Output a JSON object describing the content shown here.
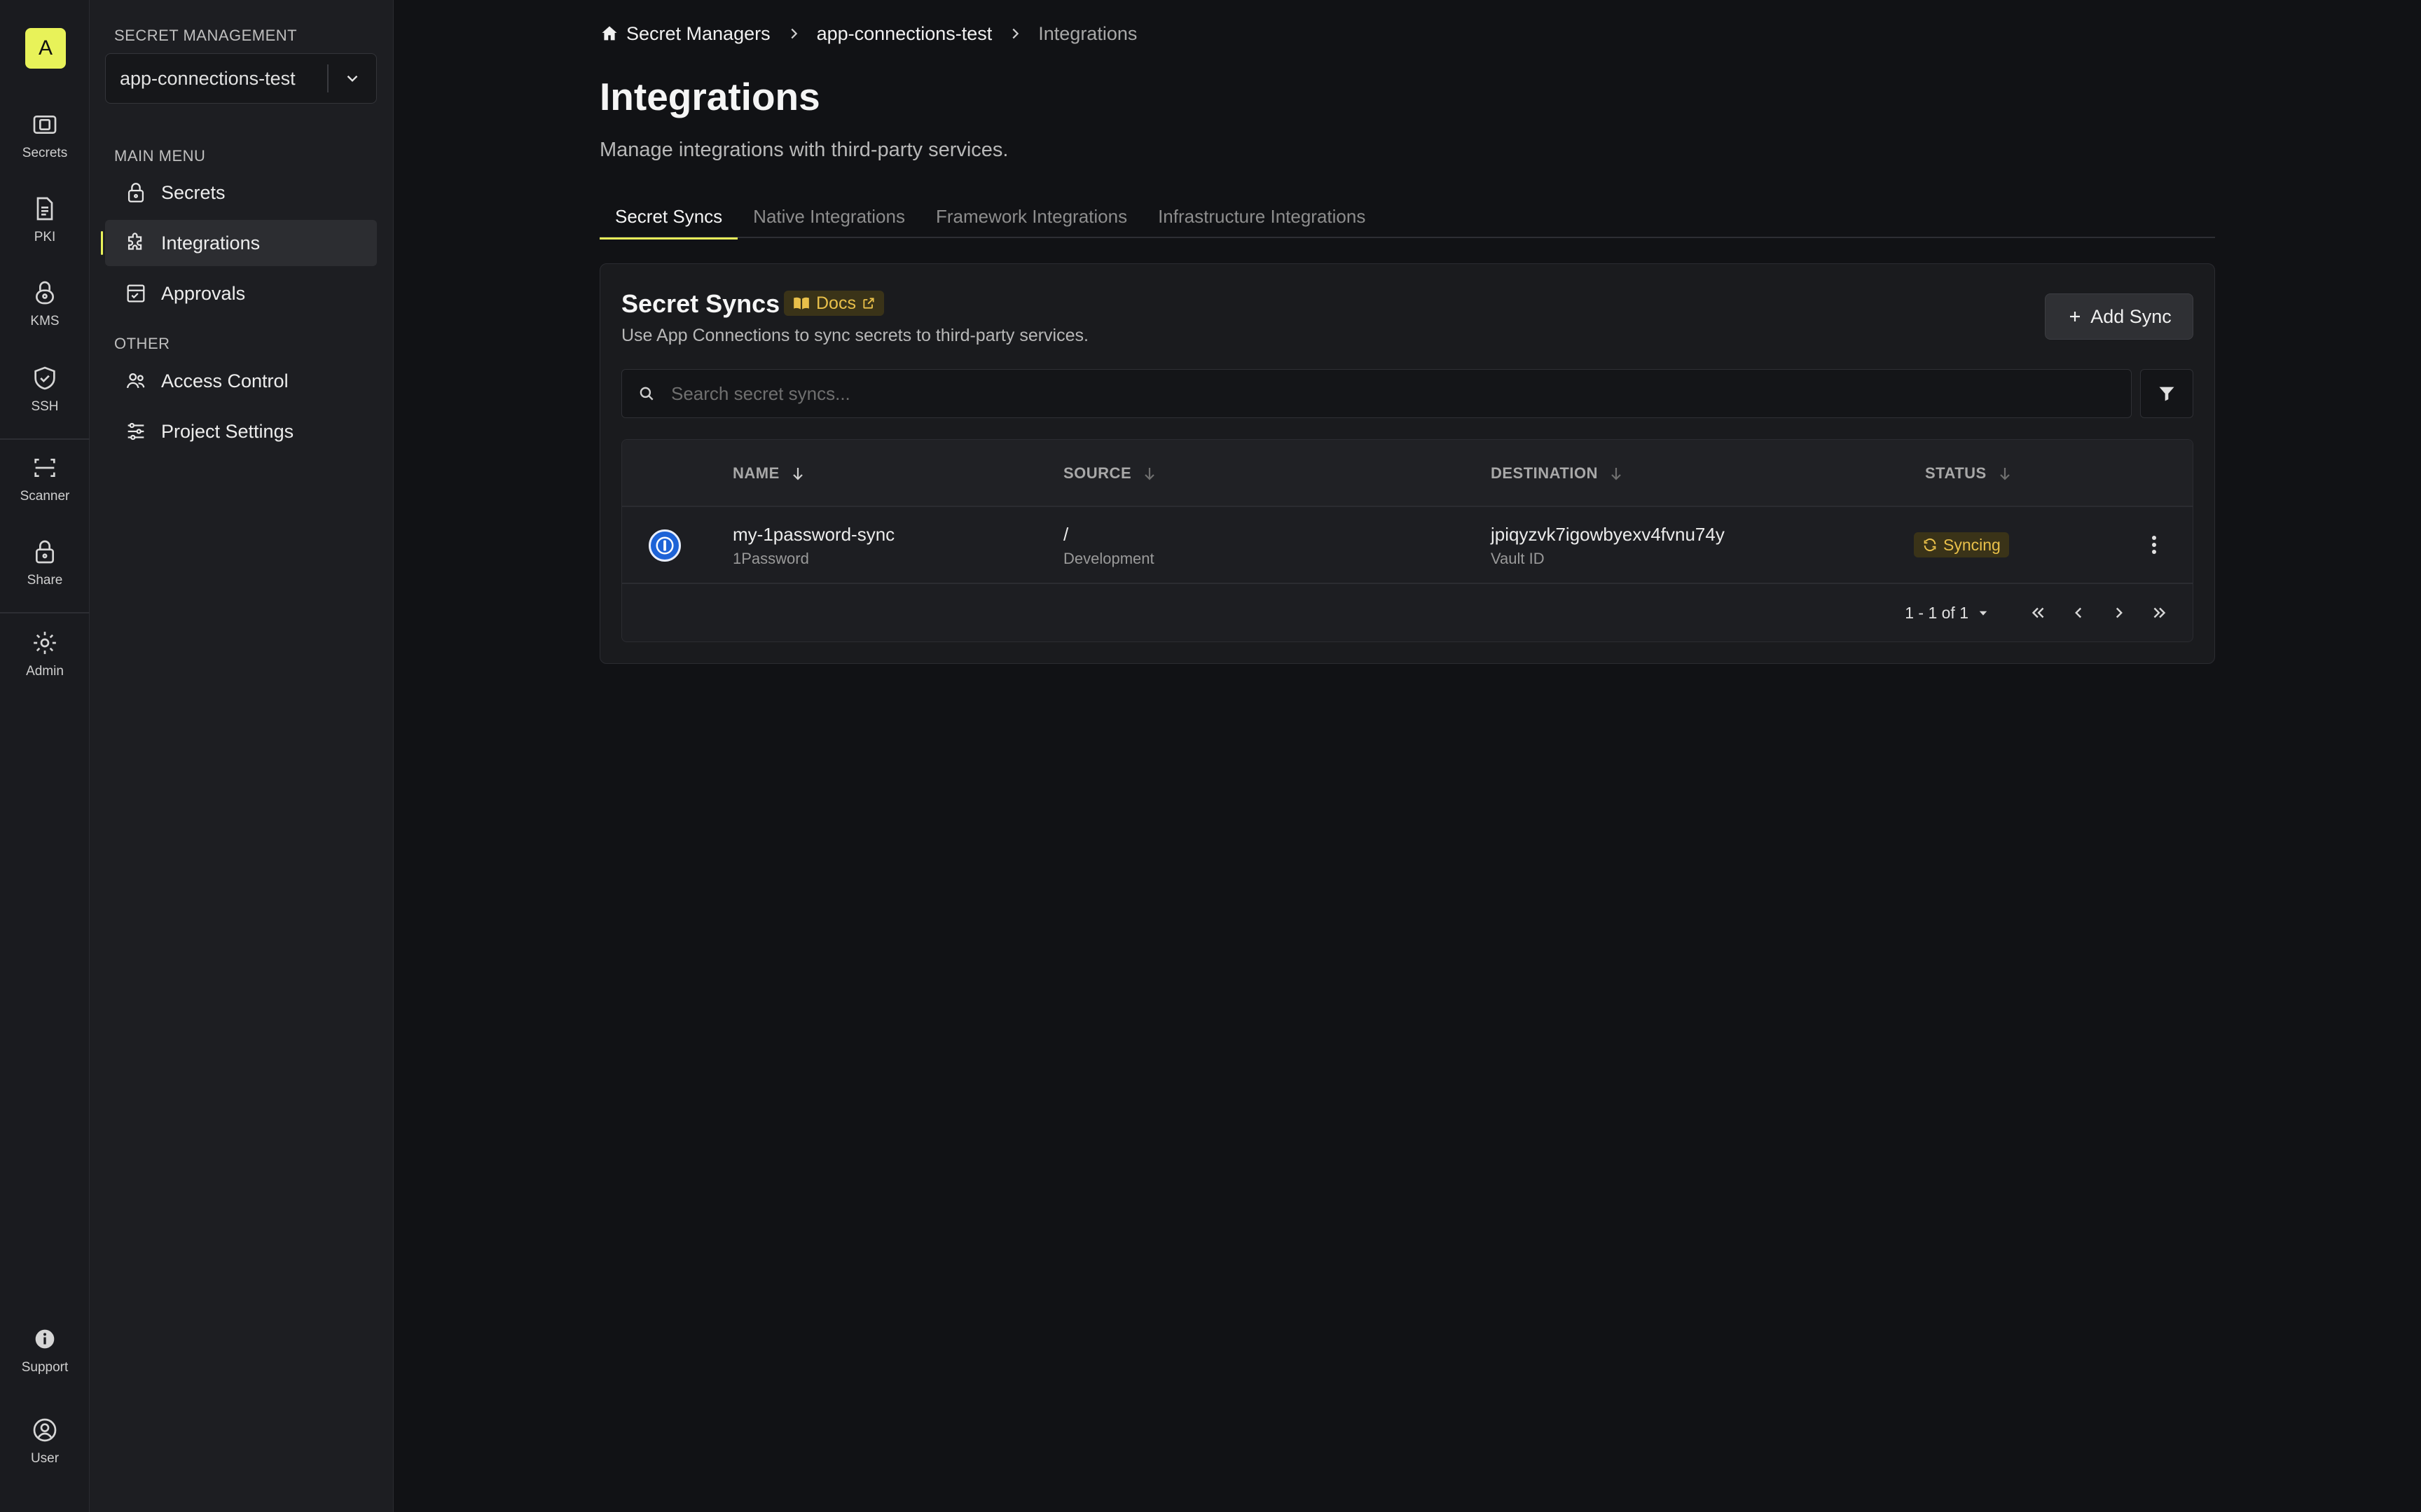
{
  "org": {
    "avatar_letter": "A"
  },
  "rail": {
    "items": [
      {
        "label": "Secrets",
        "icon": "vault-icon"
      },
      {
        "label": "PKI",
        "icon": "document-icon"
      },
      {
        "label": "KMS",
        "icon": "lock-key-icon"
      },
      {
        "label": "SSH",
        "icon": "shield-check-icon"
      },
      {
        "label": "Scanner",
        "icon": "scan-icon"
      },
      {
        "label": "Share",
        "icon": "lock-icon"
      },
      {
        "label": "Admin",
        "icon": "gear-icon"
      }
    ],
    "bottom": [
      {
        "label": "Support",
        "icon": "info-icon"
      },
      {
        "label": "User",
        "icon": "user-circle-icon"
      }
    ]
  },
  "sidebar": {
    "section_title": "SECRET MANAGEMENT",
    "project": "app-connections-test",
    "main_menu_title": "MAIN MENU",
    "main_items": [
      {
        "label": "Secrets",
        "icon": "lock-icon"
      },
      {
        "label": "Integrations",
        "icon": "puzzle-icon",
        "active": true
      },
      {
        "label": "Approvals",
        "icon": "checklist-icon"
      }
    ],
    "other_title": "OTHER",
    "other_items": [
      {
        "label": "Access Control",
        "icon": "users-icon"
      },
      {
        "label": "Project Settings",
        "icon": "sliders-icon"
      }
    ]
  },
  "breadcrumb": {
    "home": "Secret Managers",
    "project": "app-connections-test",
    "current": "Integrations"
  },
  "page": {
    "title": "Integrations",
    "subtitle": "Manage integrations with third-party services."
  },
  "tabs": [
    {
      "label": "Secret Syncs",
      "active": true
    },
    {
      "label": "Native Integrations"
    },
    {
      "label": "Framework Integrations"
    },
    {
      "label": "Infrastructure Integrations"
    }
  ],
  "card": {
    "title": "Secret Syncs",
    "docs_label": "Docs",
    "description": "Use App Connections to sync secrets to third-party services.",
    "add_button": "Add Sync",
    "search_placeholder": "Search secret syncs..."
  },
  "table": {
    "columns": [
      "NAME",
      "SOURCE",
      "DESTINATION",
      "STATUS"
    ],
    "rows": [
      {
        "name": "my-1password-sync",
        "provider": "1Password",
        "source_path": "/",
        "source_env": "Development",
        "destination": "jpiqyzvk7igowbyexv4fvnu74y",
        "destination_label": "Vault ID",
        "status": "Syncing"
      }
    ],
    "pagination": "1 - 1 of 1"
  },
  "colors": {
    "accent": "#e8f259",
    "warning_text": "#e9c04a",
    "background": "#111215"
  }
}
